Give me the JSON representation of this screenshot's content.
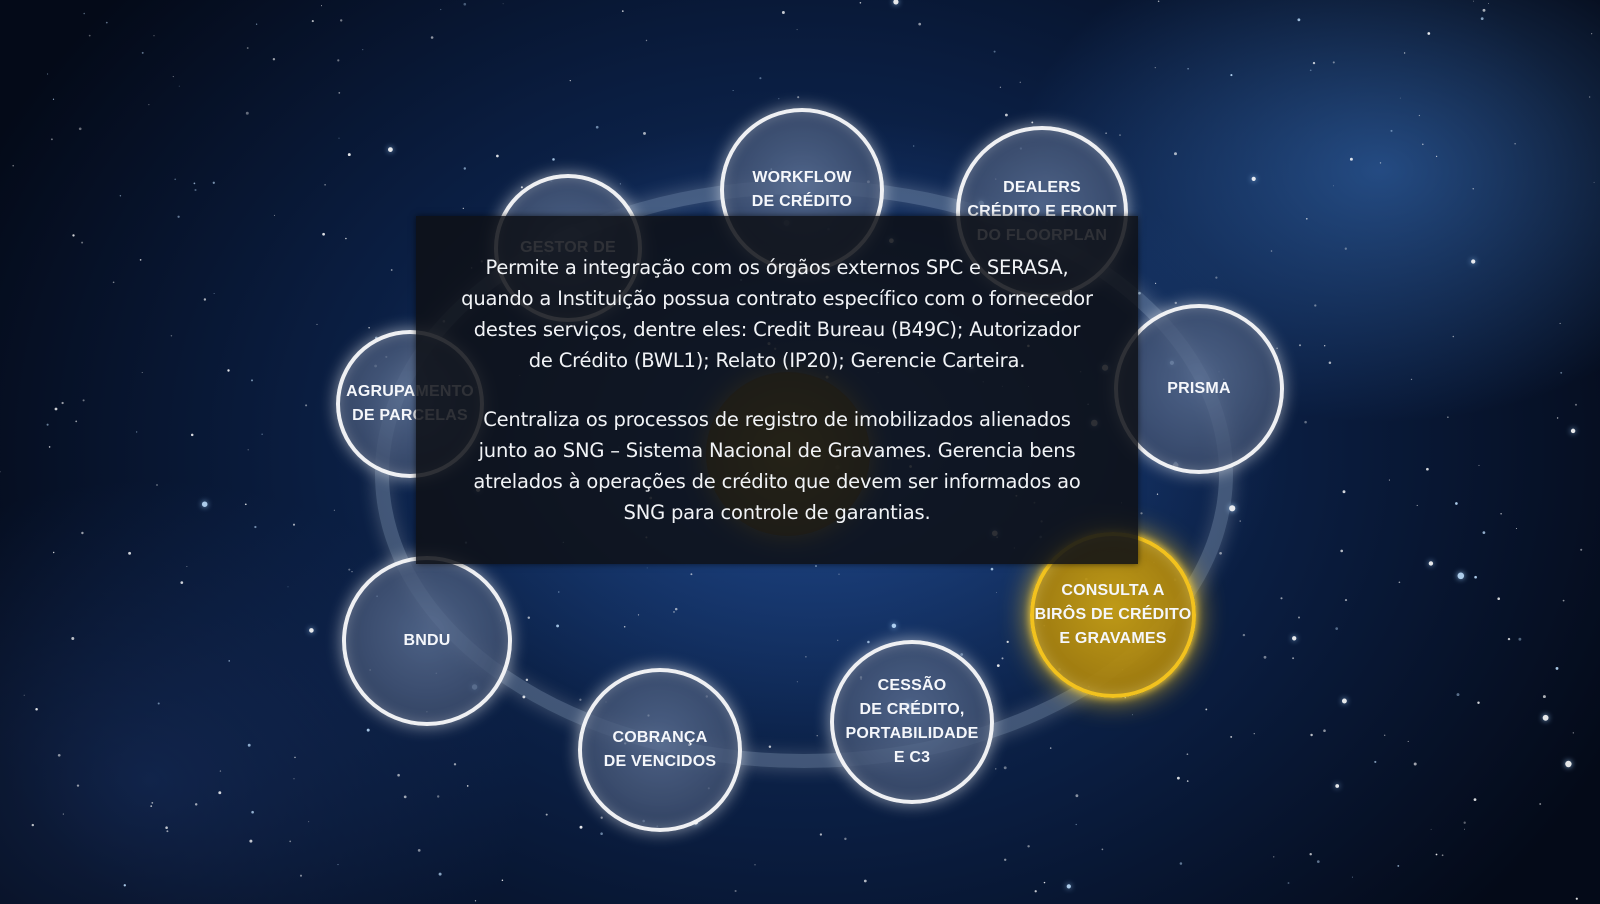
{
  "diagram": {
    "center_label": "",
    "active_node": "consulta",
    "nodes": {
      "workflow": "WORKFLOW\nDE CRÉDITO",
      "dealers": "DEALERS\nCRÉDITO E FRONT\nDO FLOORPLAN",
      "gestor": "GESTOR DE",
      "agrupamento": "AGRUPAMENTO\nDE PARCELAS",
      "prisma": "PRISMA",
      "consulta": "CONSULTA A\nBIRÔS DE CRÉDITO\nE GRAVAMES",
      "bndu": "BNDU",
      "cessao": "CESSÃO\nDE CRÉDITO,\nPORTABILIDADE\nE C3",
      "cobranca": "COBRANÇA\nDE VENCIDOS"
    }
  },
  "info_panel": {
    "paragraph_1": "Permite a integração com os órgãos externos SPC e SERASA,\nquando a Instituição possua contrato específico com o fornecedor\ndestes serviços, dentre eles: Credit Bureau (B49C); Autorizador\nde Crédito (BWL1); Relato (IP20); Gerencie Carteira.",
    "paragraph_2": "Centraliza os processos de registro de imobilizados alienados\njunto ao SNG – Sistema Nacional de Gravames. Gerencia bens\natrelados à operações de crédito que devem ser informados ao\nSNG para controle de garantias."
  },
  "colors": {
    "active_accent": "#f2c21e",
    "node_border": "#ffffff",
    "panel_background": "#0e1016",
    "sky": "#0a1d40"
  }
}
